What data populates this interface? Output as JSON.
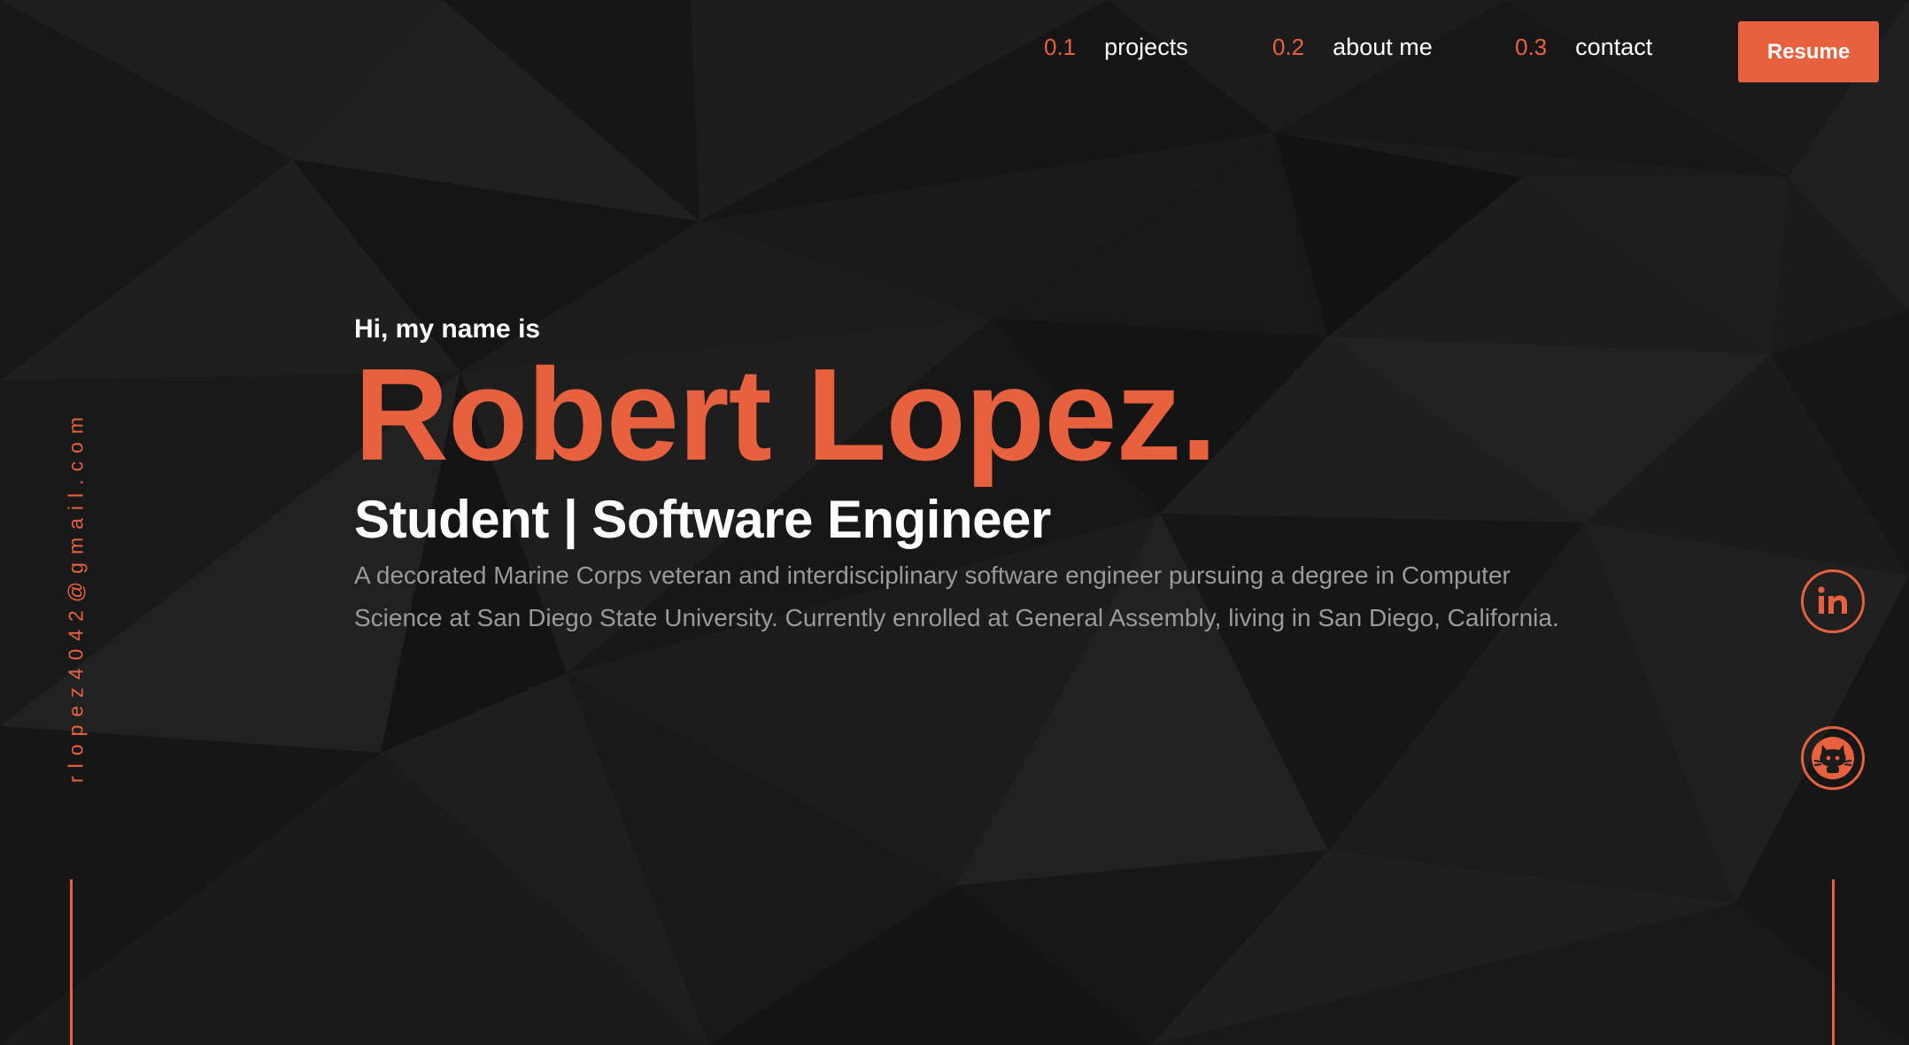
{
  "nav": {
    "items": [
      {
        "num": "0.1",
        "label": "projects"
      },
      {
        "num": "0.2",
        "label": "about me"
      },
      {
        "num": "0.3",
        "label": "contact"
      }
    ],
    "resume_label": "Resume"
  },
  "hero": {
    "greeting": "Hi, my name is",
    "name": "Robert Lopez.",
    "role": "Student | Software Engineer",
    "bio": "A decorated Marine Corps veteran and interdisciplinary software engineer pursuing a degree in Computer Science at San Diego State University. Currently enrolled at General Assembly, living in San Diego, California."
  },
  "sidebar": {
    "email": "rlopez4042@gmail.com"
  },
  "social": [
    {
      "name": "linkedin",
      "icon": "linkedin-icon"
    },
    {
      "name": "github",
      "icon": "github-icon"
    }
  ],
  "colors": {
    "accent": "#e8613e",
    "background": "#1b1b1b",
    "text": "#ffffff",
    "muted": "#9a9a9a"
  }
}
